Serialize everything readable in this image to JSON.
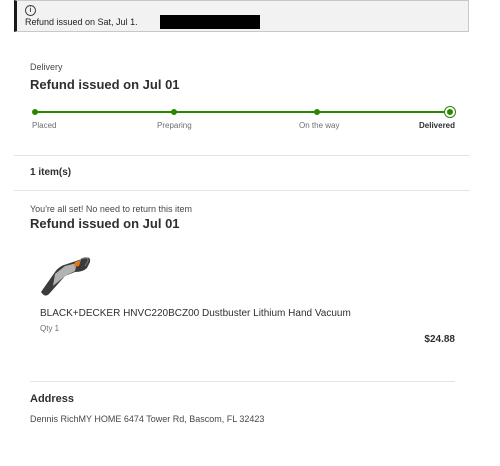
{
  "alert": {
    "icon": "info-icon",
    "text": "Refund issued on Sat, Jul 1."
  },
  "delivery": {
    "section_label": "Delivery",
    "title": "Refund issued on Jul 01",
    "progress": 1.0,
    "steps": [
      {
        "label": "Placed"
      },
      {
        "label": "Preparing"
      },
      {
        "label": "On the way"
      },
      {
        "label": "Delivered"
      }
    ],
    "accent_color": "#2a8703"
  },
  "items": {
    "count_label": "1 item(s)",
    "status_note": "You're all set! No need to return this item",
    "title": "Refund issued on Jul 01",
    "product": {
      "image_icon": "handheld-vacuum-image",
      "name": "BLACK+DECKER HNVC220BCZ00 Dustbuster Lithium Hand Vacuum",
      "qty": "Qty 1",
      "price": "$24.88"
    }
  },
  "address": {
    "title": "Address",
    "line": "Dennis RichMY HOME 6474 Tower Rd, Bascom, FL 32423"
  }
}
